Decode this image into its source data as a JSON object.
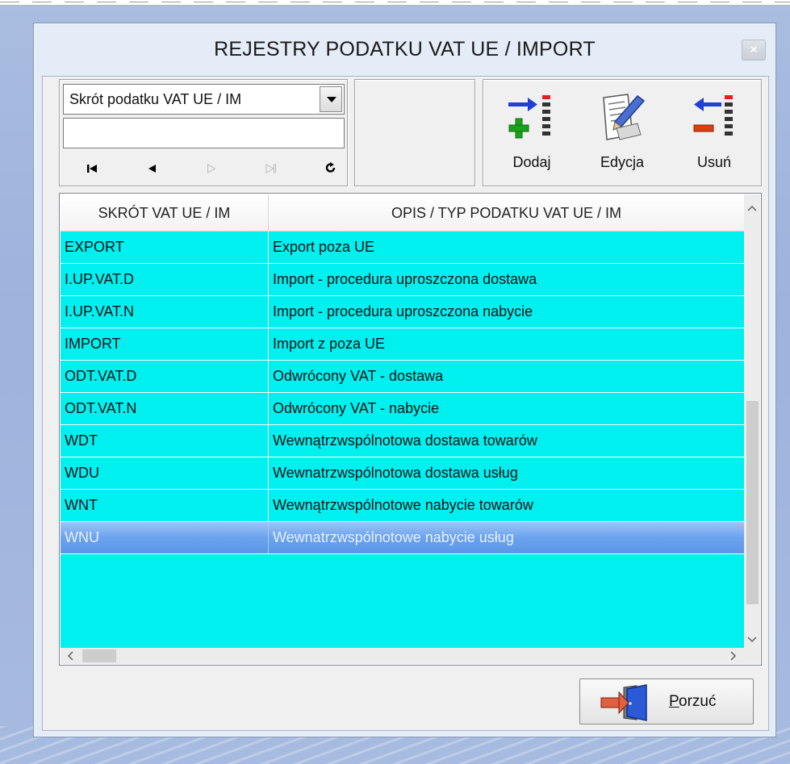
{
  "window": {
    "title": "REJESTRY PODATKU VAT UE / IMPORT",
    "close_glyph": "×"
  },
  "filter": {
    "combo_value": "Skrót podatku VAT UE / IM",
    "search_value": "",
    "nav_buttons": [
      {
        "name": "first-record",
        "glyph": "⏮"
      },
      {
        "name": "prior-record",
        "glyph": "◀"
      },
      {
        "name": "next-record",
        "glyph": "▷"
      },
      {
        "name": "last-record",
        "glyph": "⏭"
      },
      {
        "name": "refresh",
        "glyph": "↻"
      }
    ]
  },
  "toolbar": {
    "add_label": "Dodaj",
    "edit_label": "Edycja",
    "delete_label": "Usuń"
  },
  "grid": {
    "columns": [
      "SKRÓT VAT UE / IM",
      "OPIS / TYP PODATKU VAT UE / IM"
    ],
    "rows": [
      {
        "code": "EXPORT",
        "desc": "Export poza UE"
      },
      {
        "code": "I.UP.VAT.D",
        "desc": "Import - procedura uproszczona dostawa"
      },
      {
        "code": "I.UP.VAT.N",
        "desc": "Import - procedura uproszczona nabycie"
      },
      {
        "code": "IMPORT",
        "desc": "Import z poza UE"
      },
      {
        "code": "ODT.VAT.D",
        "desc": "Odwrócony VAT - dostawa"
      },
      {
        "code": "ODT.VAT.N",
        "desc": "Odwrócony VAT - nabycie"
      },
      {
        "code": "WDT",
        "desc": "Wewnątrzwspólnotowa dostawa towarów"
      },
      {
        "code": "WDU",
        "desc": "Wewnatrzwspólnotowa dostawa usług"
      },
      {
        "code": "WNT",
        "desc": "Wewnątrzwspólnotowe nabycie towarów"
      },
      {
        "code": "WNU",
        "desc": "Wewnatrzwspólnotowe nabycie usług"
      }
    ],
    "selected_index": 9
  },
  "footer": {
    "quit_label_first": "P",
    "quit_label_rest": "orzuć"
  },
  "colors": {
    "grid_background": "#00f0f0",
    "selection": "#6aa3ee",
    "window_background": "#e4ecf7"
  }
}
